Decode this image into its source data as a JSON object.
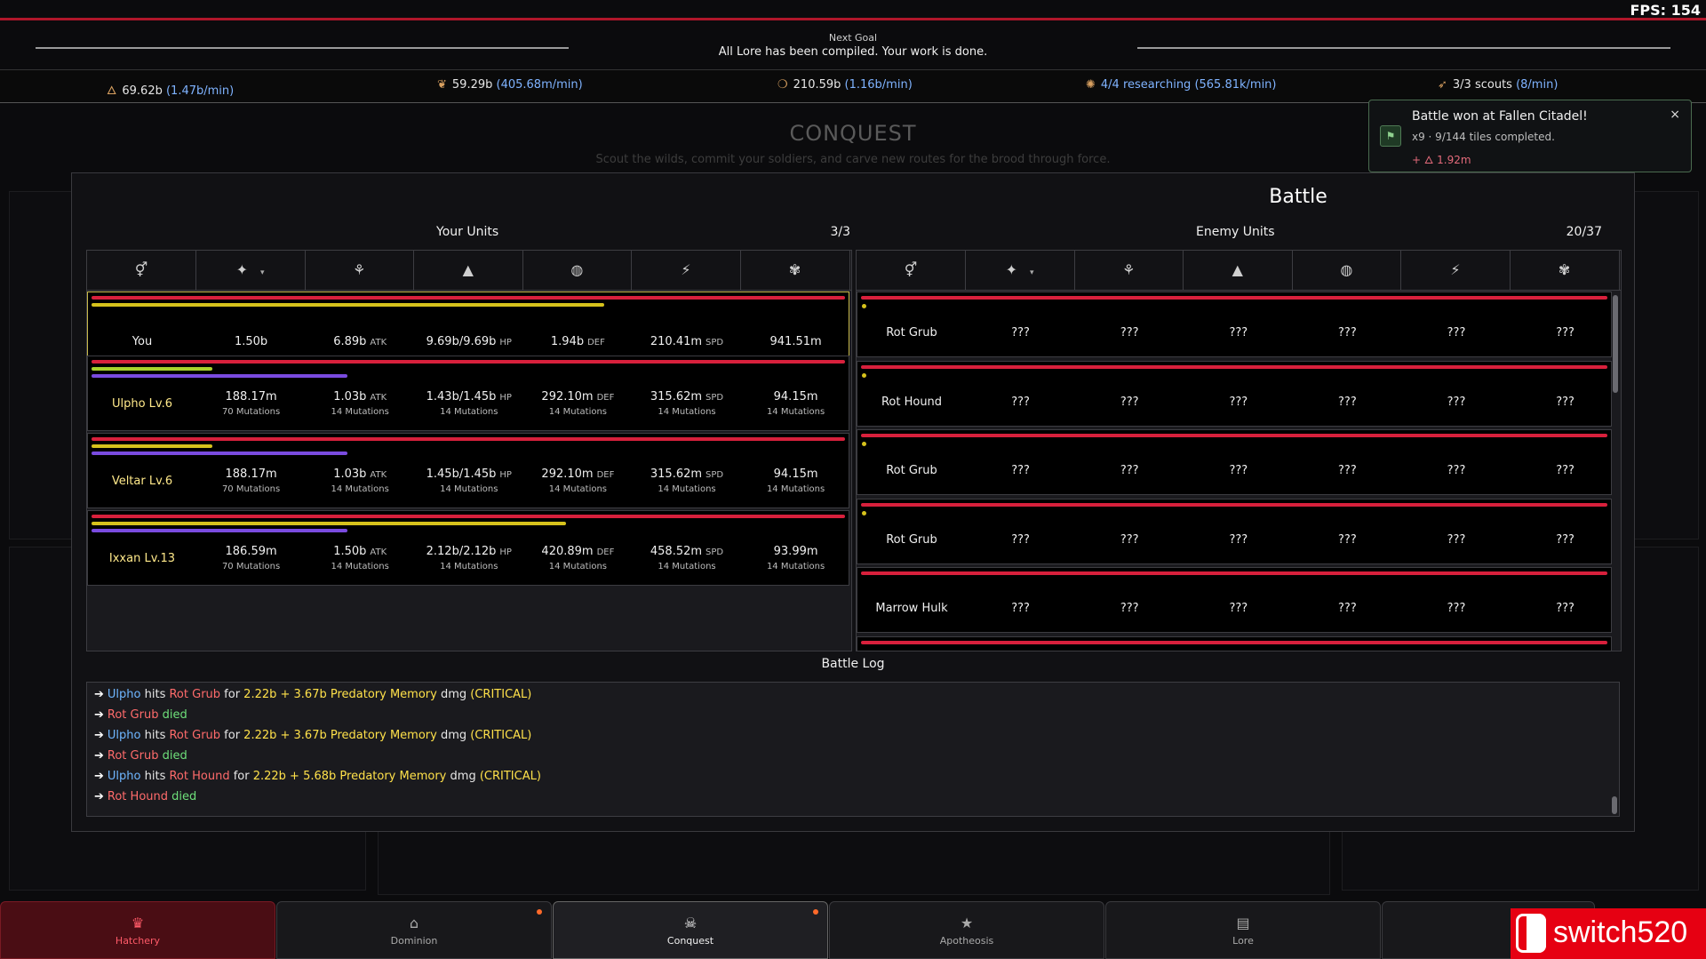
{
  "fps": "FPS: 154",
  "goal": {
    "label": "Next Goal",
    "text": "All Lore has been compiled. Your work is done."
  },
  "resources": [
    {
      "icon": "flame-icon",
      "glyph": "🜂",
      "value": "69.62b",
      "rate": "(1.47b/min)",
      "blue": false
    },
    {
      "icon": "leaf-icon",
      "glyph": "❦",
      "value": "59.29b",
      "rate": "(405.68m/min)",
      "blue": false
    },
    {
      "icon": "drop-icon",
      "glyph": "❍",
      "value": "210.59b",
      "rate": "(1.16b/min)",
      "blue": false
    },
    {
      "icon": "brain-icon",
      "glyph": "✺",
      "value": "4/4 researching",
      "rate": "(565.81k/min)",
      "blue": true
    },
    {
      "icon": "scout-icon",
      "glyph": "➶",
      "value": "3/3 scouts",
      "rate": "(8/min)",
      "blue": false
    }
  ],
  "background": {
    "title": "CONQUEST",
    "subtitle": "Scout the wilds, commit your soldiers, and carve new routes for the brood through force."
  },
  "toast": {
    "title": "Battle won at Fallen Citadel!",
    "detail": "x9 · 9/144 tiles completed.",
    "reward": "+ 🜂 1.92m",
    "close": "×"
  },
  "battle": {
    "title": "Battle",
    "your_units": {
      "title": "Your Units",
      "count": "3/3",
      "headers": [
        "⚥",
        "✦",
        "⚘",
        "▲",
        "◍",
        "⚡",
        "✾"
      ],
      "rows": [
        {
          "name": "You",
          "power": "1.50b",
          "power_m": "",
          "atk": "6.89b",
          "atk_u": "ATK",
          "hp": "9.69b/9.69b",
          "hp_u": "HP",
          "def": "1.94b",
          "def_u": "DEF",
          "spd": "210.41m",
          "spd_u": "SPD",
          "last": "941.51m",
          "mut_power": "",
          "mut": "",
          "yellow": 0.68,
          "green": 0,
          "purple": 0
        },
        {
          "name": "Ulpho Lv.6",
          "power": "188.17m",
          "atk": "1.03b",
          "atk_u": "ATK",
          "hp": "1.43b/1.45b",
          "hp_u": "HP",
          "def": "292.10m",
          "def_u": "DEF",
          "spd": "315.62m",
          "spd_u": "SPD",
          "last": "94.15m",
          "mut_power": "70 Mutations",
          "mut": "14 Mutations",
          "yellow": 0,
          "green": 0.16,
          "purple": 0.34
        },
        {
          "name": "Veltar Lv.6",
          "power": "188.17m",
          "atk": "1.03b",
          "atk_u": "ATK",
          "hp": "1.45b/1.45b",
          "hp_u": "HP",
          "def": "292.10m",
          "def_u": "DEF",
          "spd": "315.62m",
          "spd_u": "SPD",
          "last": "94.15m",
          "mut_power": "70 Mutations",
          "mut": "14 Mutations",
          "yellow": 0.16,
          "green": 0,
          "purple": 0.34
        },
        {
          "name": "Ixxan Lv.13",
          "power": "186.59m",
          "atk": "1.50b",
          "atk_u": "ATK",
          "hp": "2.12b/2.12b",
          "hp_u": "HP",
          "def": "420.89m",
          "def_u": "DEF",
          "spd": "458.52m",
          "spd_u": "SPD",
          "last": "93.99m",
          "mut_power": "70 Mutations",
          "mut": "14 Mutations",
          "yellow": 0.63,
          "green": 0,
          "purple": 0.34
        }
      ]
    },
    "enemy_units": {
      "title": "Enemy Units",
      "count": "20/37",
      "headers": [
        "⚥",
        "✦",
        "⚘",
        "▲",
        "◍",
        "⚡",
        "✾"
      ],
      "unknown": "???",
      "rows": [
        {
          "name": "Rot Grub",
          "dot": true
        },
        {
          "name": "Rot Hound",
          "dot": true
        },
        {
          "name": "Rot Grub",
          "dot": true
        },
        {
          "name": "Rot Grub",
          "dot": true
        },
        {
          "name": "Marrow Hulk",
          "dot": false
        }
      ]
    },
    "log": {
      "title": "Battle Log",
      "entries": [
        {
          "type": "hit",
          "attacker": "Ulpho",
          "verb": "hits",
          "target": "Rot Grub",
          "for": "for",
          "dmg": "2.22b + 3.67b Predatory Memory",
          "dmgword": "dmg",
          "crit": "(CRITICAL)"
        },
        {
          "type": "die",
          "target": "Rot Grub",
          "verb": "died"
        },
        {
          "type": "hit",
          "attacker": "Ulpho",
          "verb": "hits",
          "target": "Rot Grub",
          "for": "for",
          "dmg": "2.22b + 3.67b Predatory Memory",
          "dmgword": "dmg",
          "crit": "(CRITICAL)"
        },
        {
          "type": "die",
          "target": "Rot Grub",
          "verb": "died"
        },
        {
          "type": "hit",
          "attacker": "Ulpho",
          "verb": "hits",
          "target": "Rot Hound",
          "for": "for",
          "dmg": "2.22b + 5.68b Predatory Memory",
          "dmgword": "dmg",
          "crit": "(CRITICAL)"
        },
        {
          "type": "die",
          "target": "Rot Hound",
          "verb": "died"
        }
      ]
    }
  },
  "nav": {
    "tabs": [
      {
        "label": "Hatchery",
        "icon": "crown-icon",
        "glyph": "♛",
        "state": "hatch",
        "notif": false
      },
      {
        "label": "Dominion",
        "icon": "home-icon",
        "glyph": "⌂",
        "state": "",
        "notif": true
      },
      {
        "label": "Conquest",
        "icon": "skull-icon",
        "glyph": "☠",
        "state": "active",
        "notif": true
      },
      {
        "label": "Apotheosis",
        "icon": "star-icon",
        "glyph": "★",
        "state": "",
        "notif": false
      },
      {
        "label": "Lore",
        "icon": "scroll-icon",
        "glyph": "▤",
        "state": "",
        "notif": false
      }
    ]
  },
  "watermark": "switch520"
}
